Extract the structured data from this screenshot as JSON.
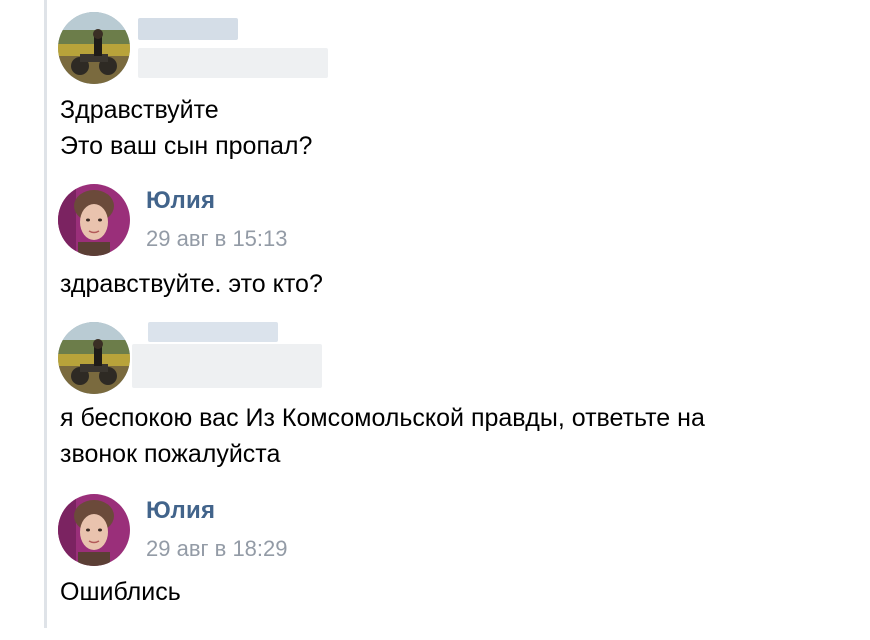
{
  "messages": [
    {
      "author": "",
      "time": "",
      "lines": [
        "Здравствуйте",
        "Это ваш сын пропал?"
      ]
    },
    {
      "author": "Юлия",
      "time": "29 авг в 15:13",
      "lines": [
        "здравствуйте. это кто?"
      ]
    },
    {
      "author": "",
      "time": "",
      "lines": [
        "я беспокою вас Из Комсомольской правды, ответьте на",
        "звонок пожалуйста"
      ]
    },
    {
      "author": "Юлия",
      "time": "29 авг в 18:29",
      "lines": [
        "Ошиблись"
      ]
    }
  ],
  "colors": {
    "author_name": "#42648b",
    "timestamp": "#939ba6",
    "text": "#000000",
    "thread_border": "#dfe3e8"
  }
}
